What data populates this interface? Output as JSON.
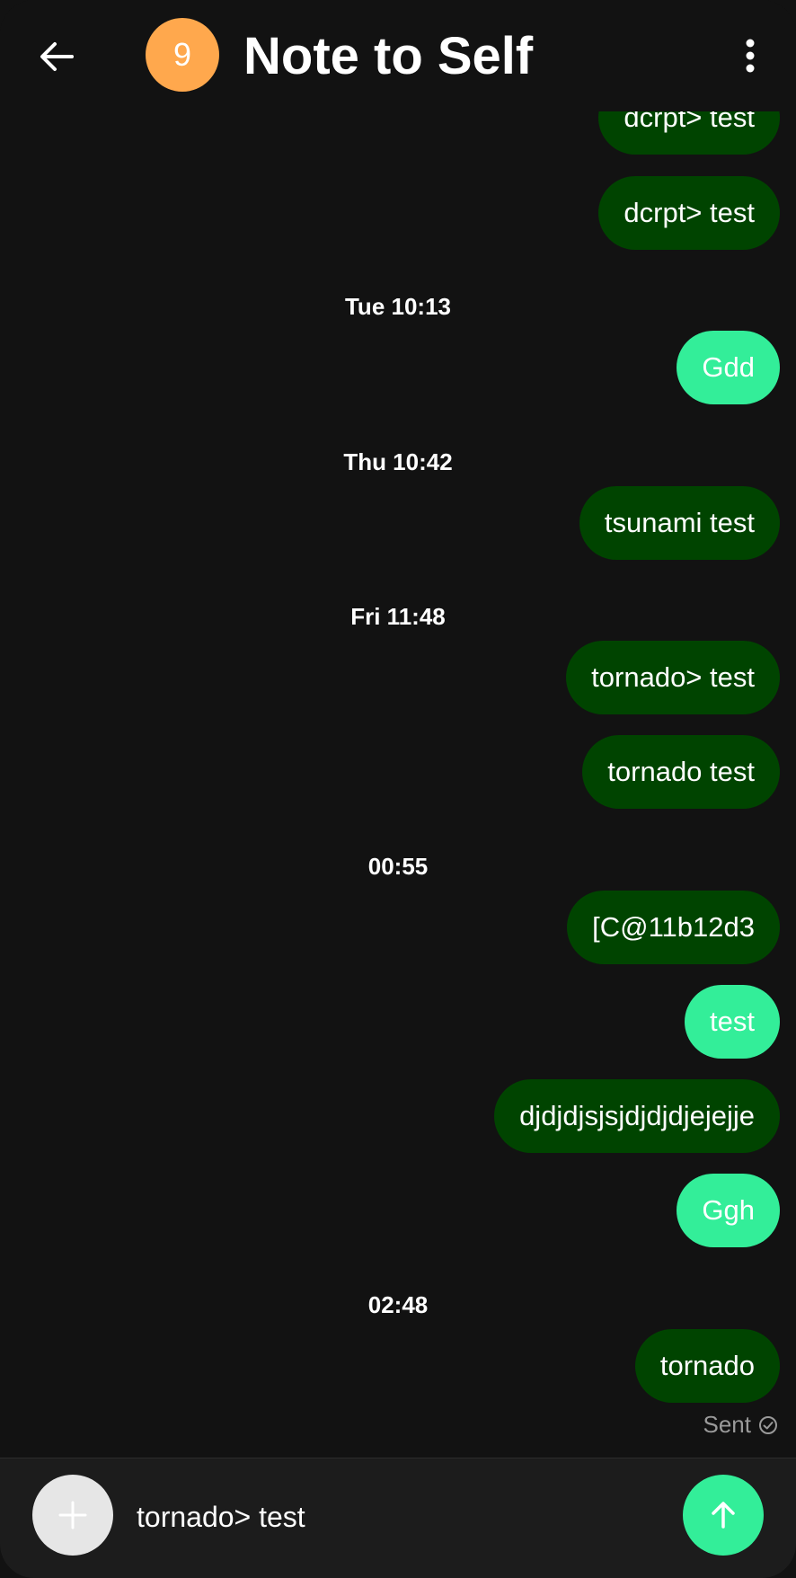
{
  "header": {
    "back_icon": "arrow-left-icon",
    "avatar_text": "9",
    "avatar_color": "#ffa84d",
    "title": "Note to Self",
    "menu_icon": "more-vertical-icon"
  },
  "colors": {
    "outgoing_dark": "#004400",
    "outgoing_light": "#33ee99",
    "background": "#121212"
  },
  "timestamps": [
    "Tue 10:13",
    "Thu 10:42",
    "Fri 11:48",
    "00:55",
    "02:48"
  ],
  "messages": [
    {
      "text": "dcrpt> test",
      "style": "dark"
    },
    {
      "text": "dcrpt> test",
      "style": "dark"
    },
    {
      "text": "Gdd",
      "style": "light"
    },
    {
      "text": "tsunami test",
      "style": "dark"
    },
    {
      "text": "tornado> test",
      "style": "dark"
    },
    {
      "text": "tornado test",
      "style": "dark"
    },
    {
      "text": "[C@11b12d3",
      "style": "dark"
    },
    {
      "text": "test",
      "style": "light"
    },
    {
      "text": "djdjdjsjsjdjdjdjejejje",
      "style": "dark"
    },
    {
      "text": "Ggh",
      "style": "light"
    },
    {
      "text": "tornado",
      "style": "dark"
    }
  ],
  "status": {
    "label": "Sent",
    "icon": "check-circle-icon"
  },
  "composer": {
    "attach_icon": "plus-icon",
    "value": "tornado> test",
    "send_icon": "arrow-up-icon"
  }
}
